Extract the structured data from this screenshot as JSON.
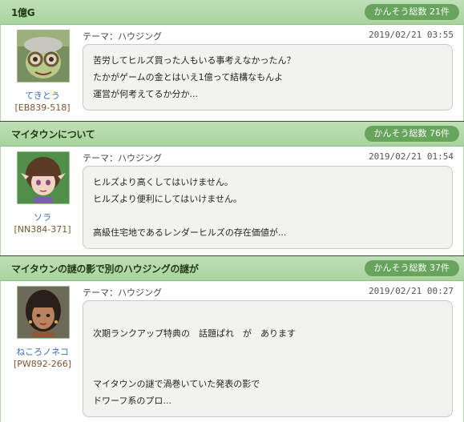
{
  "threads": [
    {
      "title": "1億G",
      "count_label": "かんそう総数 21件",
      "author": {
        "name": "てきとう",
        "id": "[EB839-518]",
        "avatar": "avatar-goggle-green"
      },
      "theme": "テーマ：ハウジング",
      "date": "2019/02/21 03:55",
      "lines": [
        "苦労してヒルズ買った人もいる事考えなかったん？",
        "たかがゲームの金とはいえ1億って結構なもんよ",
        "運営が何考えてるか分か..."
      ]
    },
    {
      "title": "マイタウンについて",
      "count_label": "かんそう総数 76件",
      "author": {
        "name": "ソラ",
        "id": "[NN384-371]",
        "avatar": "avatar-elf-girl"
      },
      "theme": "テーマ：ハウジング",
      "date": "2019/02/21 01:54",
      "lines": [
        "ヒルズより高くしてはいけません。",
        "ヒルズより便利にしてはいけません。",
        "",
        "高級住宅地であるレンダーヒルズの存在価値が..."
      ]
    },
    {
      "title": "マイタウンの謎の影で別のハウジングの謎が",
      "count_label": "かんそう総数 37件",
      "author": {
        "name": "ねころノネコ",
        "id": "[PW892-266]",
        "avatar": "avatar-dark-hair"
      },
      "theme": "テーマ：ハウジング",
      "date": "2019/02/21 00:27",
      "lines": [
        "",
        "次期ランクアップ特典の　話題ぱれ　が　あります",
        "",
        "",
        "マイタウンの謎で渦巻いていた発表の影で",
        "ドワーフ系のプロ..."
      ]
    }
  ],
  "colors": {
    "header_bg": "#b5d9ab",
    "pill_bg": "#67a45c",
    "author_name": "#3a6fb0",
    "author_id": "#7a5430"
  }
}
